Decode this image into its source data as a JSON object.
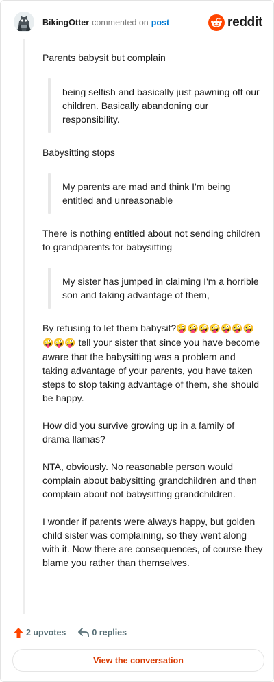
{
  "header": {
    "username": "BikingOtter",
    "action": "commented on",
    "post_link": "post",
    "brand": "reddit",
    "brand_color": "#ff4500"
  },
  "comment": {
    "p1": "Parents babysit but complain",
    "q1": "being selfish and basically just pawning off our children. Basically abandoning our responsibility.",
    "p2": "Babysitting stops",
    "q2": "My parents are mad and think I'm being entitled and unreasonable",
    "p3": "There is nothing entitled about not sending children to grandparents for babysitting",
    "q3": "My sister has jumped in claiming I'm a horrible son and taking advantage of them,",
    "p4_lead": "By refusing to let them babysit?",
    "p4_emoji": "🤪🤪🤪🤪🤪🤪🤪🤪🤪🤪",
    "p4_rest": " tell your sister that since you have become aware that the babysitting was a problem and taking advantage of your parents, you have taken steps to stop taking advantage of them, she should be happy.",
    "p5": "How did you survive growing up in a family of drama llamas?",
    "p6": "NTA, obviously. No reasonable person would complain about babysitting grandchildren and then complain about not babysitting grandchildren.",
    "p7": "I wonder if parents were always happy, but golden child sister was complaining, so they went along with it. Now there are consequences, of course they blame you rather than themselves."
  },
  "footer": {
    "upvotes": "2 upvotes",
    "replies": "0 replies",
    "upvote_icon": "upvote-arrow-icon",
    "reply_icon": "reply-arrow-icon",
    "upvote_color": "#ff4500"
  },
  "cta": {
    "label": "View the conversation",
    "color": "#d93a00"
  }
}
